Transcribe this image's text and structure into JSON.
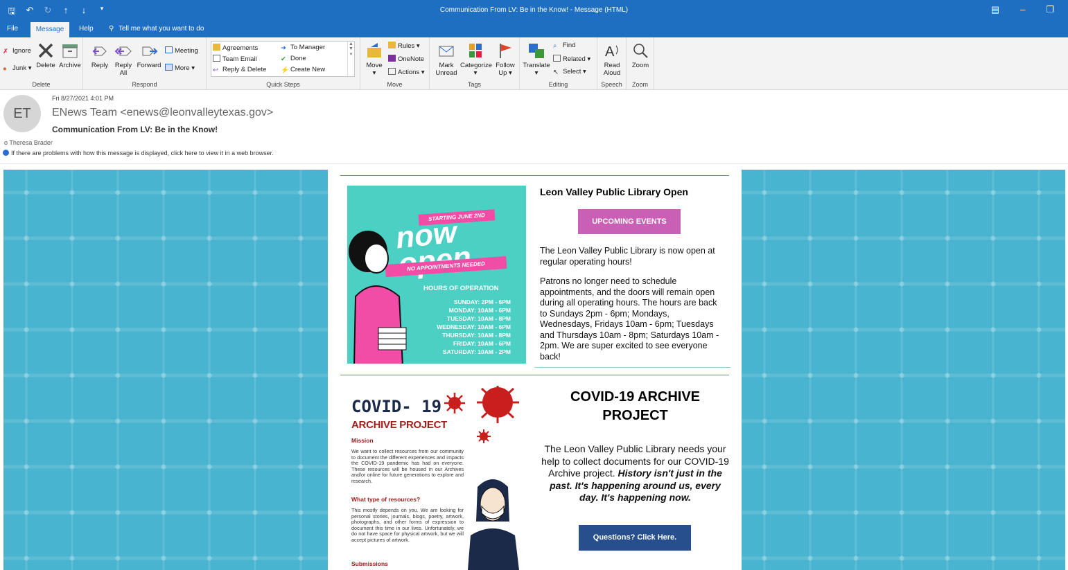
{
  "window": {
    "title": "Communication From LV: Be in the Know!  -  Message (HTML)",
    "quick_access": [
      "save-icon",
      "undo-icon",
      "redo-icon",
      "up-icon",
      "down-icon",
      "customize-icon"
    ],
    "controls": [
      "restore-icon",
      "minimize-icon",
      "maximize-icon"
    ]
  },
  "menu": {
    "file": "File",
    "message": "Message",
    "help": "Help",
    "tell_me": "Tell me what you want to do"
  },
  "ribbon": {
    "delete_group": {
      "label": "Delete",
      "ignore": "Ignore",
      "junk": "Junk",
      "delete": "Delete",
      "archive": "Archive"
    },
    "respond_group": {
      "label": "Respond",
      "reply": "Reply",
      "reply_all_1": "Reply",
      "reply_all_2": "All",
      "forward": "Forward",
      "meeting": "Meeting",
      "more": "More"
    },
    "quick_steps": {
      "label": "Quick Steps",
      "items": [
        "Agreements",
        "To Manager",
        "Team Email",
        "Done",
        "Reply & Delete",
        "Create New"
      ]
    },
    "move_group": {
      "label": "Move",
      "move": "Move",
      "rules": "Rules",
      "onenote": "OneNote",
      "actions": "Actions"
    },
    "tags_group": {
      "label": "Tags",
      "mark_unread_1": "Mark",
      "mark_unread_2": "Unread",
      "categorize": "Categorize",
      "follow_up_1": "Follow",
      "follow_up_2": "Up"
    },
    "editing_group": {
      "label": "Editing",
      "translate": "Translate",
      "find": "Find",
      "related": "Related",
      "select": "Select"
    },
    "speech_group": {
      "label": "Speech",
      "read_aloud_1": "Read",
      "read_aloud_2": "Aloud"
    },
    "zoom_group": {
      "label": "Zoom",
      "zoom": "Zoom"
    }
  },
  "message": {
    "avatar_initials": "ET",
    "date": "Fri 8/27/2021 4:01 PM",
    "from": "ENews Team <enews@leonvalleytexas.gov>",
    "subject": "Communication From LV: Be in the Know!",
    "to": "o   Theresa Brader",
    "info": "If there are problems with how this message is displayed, click here to view it in a web browser."
  },
  "library": {
    "image": {
      "starting": "STARTING JUNE 2ND",
      "now": "now",
      "open": "open",
      "no_appt": "NO APPOINTMENTS NEEDED",
      "hours_title": "HOURS OF OPERATION",
      "hours": [
        "SUNDAY:  2PM - 6PM",
        "MONDAY:  10AM - 6PM",
        "TUESDAY:  10AM - 8PM",
        "WEDNESDAY:  10AM - 6PM",
        "THURSDAY:  10AM - 8PM",
        "FRIDAY:  10AM - 6PM",
        "SATURDAY:  10AM - 2PM"
      ]
    },
    "title": "Leon Valley Public Library Open",
    "button": "UPCOMING EVENTS",
    "p1": "The Leon Valley Public Library is now open at regular operating hours!",
    "p2": "Patrons no longer need to schedule appointments, and the doors will remain open during all operating hours. The hours are back to Sundays 2pm - 6pm; Mondays, Wednesdays, Fridays 10am - 6pm; Tuesdays and Thursdays 10am - 8pm; Saturdays 10am - 2pm. We are super excited to see everyone back!"
  },
  "covid": {
    "image": {
      "title": "COVID- 19",
      "subtitle": "ARCHIVE PROJECT",
      "mission_h": "Mission",
      "mission_t": "We want to collect resources from our community to document the different experiences and impacts the COVID-19 pandemic has had on everyone. These resources will be housed in our Archives and/or online for future generations to explore and research.",
      "type_h": "What type of resources?",
      "type_t": "This mostly depends on you. We are looking for personal stories, journals, blogs, poetry, artwork, photographs, and other forms of expression to document this time in our lives. Unfortunately, we do not have space for physical artwork, but we will accept pictures of artwork.",
      "sub_h": "Submissions"
    },
    "title": "COVID-19 ARCHIVE PROJECT",
    "p": "The Leon Valley Public Library needs your help to collect documents for our COVID-19 Archive project.",
    "em": "History isn't just in the past. It's happening around us, every day. It's happening now.",
    "button": "Questions? Click Here."
  },
  "colors": {
    "accent": "#1e6fc1",
    "pattern_bg": "#48b4cf",
    "events_button": "#c960b6",
    "questions_button": "#274f8e",
    "lib_image_bg": "#4dd0c4",
    "pink": "#f14ca6",
    "covid_red": "#a31d1d"
  }
}
